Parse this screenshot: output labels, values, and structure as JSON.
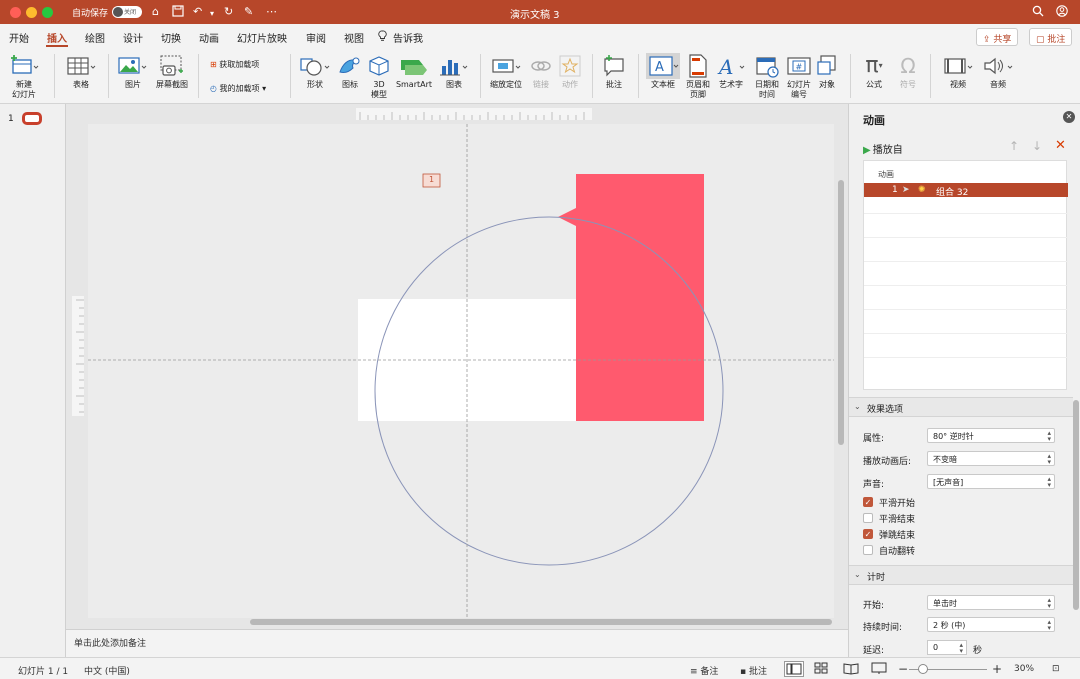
{
  "window": {
    "title": "演示文稿 3",
    "autosave_label": "自动保存",
    "autosave_state": "关闭"
  },
  "tabs": [
    "开始",
    "插入",
    "绘图",
    "设计",
    "切换",
    "动画",
    "幻灯片放映",
    "审阅",
    "视图"
  ],
  "active_tab": "插入",
  "tell_me": "告诉我",
  "share_label": "共享",
  "comment_label": "批注",
  "ribbon": {
    "new_slide": [
      "新建",
      "幻灯片"
    ],
    "table": "表格",
    "picture": "图片",
    "screenshot": "屏幕截图",
    "get_addins": "获取加载项",
    "my_addins": "我的加载项",
    "shapes": "形状",
    "icons": "图标",
    "model3d": [
      "3D",
      "模型"
    ],
    "smartart": "SmartArt",
    "chart": "图表",
    "zoom": "缩放定位",
    "link": "链接",
    "action": "动作",
    "comment": "批注",
    "textbox": "文本框",
    "header_footer": [
      "页眉和",
      "页脚"
    ],
    "wordart": "艺术字",
    "datetime": [
      "日期和",
      "时间"
    ],
    "slide_number": [
      "幻灯片",
      "编号"
    ],
    "object": "对象",
    "equation": "公式",
    "symbol": "符号",
    "video": "视频",
    "audio": "音频"
  },
  "thumb_number": "1",
  "slide": {
    "anim_tag": "1"
  },
  "notes_placeholder": "单击此处添加备注",
  "panel": {
    "title": "动画",
    "play_from": "播放自",
    "list_header": "动画",
    "item_number": "1",
    "item_name": "组合 32",
    "effects_section": "效果选项",
    "property_label": "属性:",
    "property_value": "80° 逆时针",
    "after_label": "播放动画后:",
    "after_value": "不变暗",
    "sound_label": "声音:",
    "sound_value": "[无声音]",
    "checks": [
      {
        "label": "平滑开始",
        "checked": true
      },
      {
        "label": "平滑结束",
        "checked": false
      },
      {
        "label": "弹跳结束",
        "checked": true
      },
      {
        "label": "自动翻转",
        "checked": false
      }
    ],
    "timing_section": "计时",
    "start_label": "开始:",
    "start_value": "单击时",
    "duration_label": "持续时间:",
    "duration_value": "2 秒 (中)",
    "delay_label": "延迟:",
    "delay_value": "0",
    "delay_unit": "秒"
  },
  "status": {
    "slide_info": "幻灯片 1 / 1",
    "language": "中文 (中国)",
    "notes": "备注",
    "comments": "批注",
    "zoom_minus": "−",
    "zoom_plus": "+",
    "zoom": "30%"
  },
  "colors": {
    "brand": "#b7472a",
    "shape_red": "#ff5a6e",
    "circle": "#8a94b8"
  }
}
